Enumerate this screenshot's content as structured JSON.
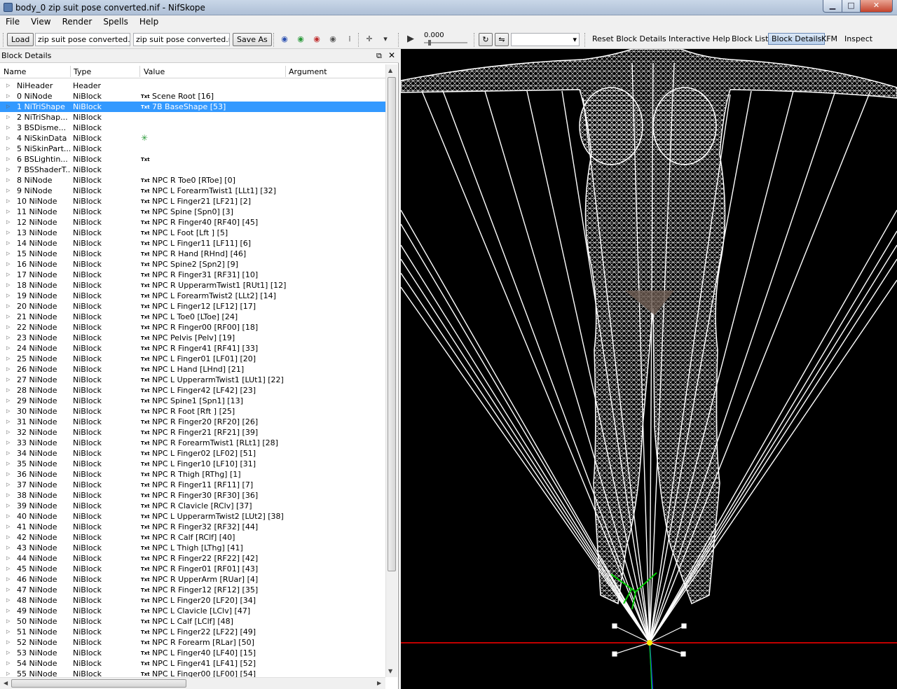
{
  "window": {
    "title": "body_0 zip suit pose converted.nif - NifSkope"
  },
  "menu": [
    "File",
    "View",
    "Render",
    "Spells",
    "Help"
  ],
  "toolbar": {
    "load": "Load",
    "file_left": "zip suit pose converted.nif",
    "file_right": "zip suit pose converted.nif",
    "save_as": "Save As",
    "time_value": "0.000",
    "links": [
      "Reset Block Details",
      "Interactive Help",
      "Block List",
      "Block Details",
      "KFM",
      "Inspect"
    ]
  },
  "panel": {
    "title": "Block Details",
    "columns": [
      "Name",
      "Type",
      "Value",
      "Argument"
    ],
    "rows": [
      {
        "name": "NiHeader",
        "type": "Header",
        "value": "",
        "txt": false
      },
      {
        "name": "0 NiNode",
        "type": "NiBlock",
        "value": "Scene Root [16]",
        "txt": true
      },
      {
        "name": "1 NiTriShape",
        "type": "NiBlock",
        "value": "7B BaseShape [53]",
        "txt": true,
        "selected": true
      },
      {
        "name": "2 NiTriShap...",
        "type": "NiBlock",
        "value": "",
        "txt": false
      },
      {
        "name": "3 BSDisme...",
        "type": "NiBlock",
        "value": "",
        "txt": false
      },
      {
        "name": "4 NiSkinData",
        "type": "NiBlock",
        "value": "",
        "txt": false,
        "axis_icon": true
      },
      {
        "name": "5 NiSkinPart...",
        "type": "NiBlock",
        "value": "",
        "txt": false
      },
      {
        "name": "6 BSLightin...",
        "type": "NiBlock",
        "value": "",
        "txt": true
      },
      {
        "name": "7 BSShaderT...",
        "type": "NiBlock",
        "value": "",
        "txt": false
      },
      {
        "name": "8 NiNode",
        "type": "NiBlock",
        "value": "NPC R Toe0 [RToe] [0]",
        "txt": true
      },
      {
        "name": "9 NiNode",
        "type": "NiBlock",
        "value": "NPC L ForearmTwist1 [LLt1] [32]",
        "txt": true
      },
      {
        "name": "10 NiNode",
        "type": "NiBlock",
        "value": "NPC L Finger21 [LF21] [2]",
        "txt": true
      },
      {
        "name": "11 NiNode",
        "type": "NiBlock",
        "value": "NPC Spine [Spn0] [3]",
        "txt": true
      },
      {
        "name": "12 NiNode",
        "type": "NiBlock",
        "value": "NPC R Finger40 [RF40] [45]",
        "txt": true
      },
      {
        "name": "13 NiNode",
        "type": "NiBlock",
        "value": "NPC L Foot [Lft ] [5]",
        "txt": true
      },
      {
        "name": "14 NiNode",
        "type": "NiBlock",
        "value": "NPC L Finger11 [LF11] [6]",
        "txt": true
      },
      {
        "name": "15 NiNode",
        "type": "NiBlock",
        "value": "NPC R Hand [RHnd] [46]",
        "txt": true
      },
      {
        "name": "16 NiNode",
        "type": "NiBlock",
        "value": "NPC Spine2 [Spn2] [9]",
        "txt": true
      },
      {
        "name": "17 NiNode",
        "type": "NiBlock",
        "value": "NPC R Finger31 [RF31] [10]",
        "txt": true
      },
      {
        "name": "18 NiNode",
        "type": "NiBlock",
        "value": "NPC R UpperarmTwist1 [RUt1] [12]",
        "txt": true
      },
      {
        "name": "19 NiNode",
        "type": "NiBlock",
        "value": "NPC L ForearmTwist2 [LLt2] [14]",
        "txt": true
      },
      {
        "name": "20 NiNode",
        "type": "NiBlock",
        "value": "NPC L Finger12 [LF12] [17]",
        "txt": true
      },
      {
        "name": "21 NiNode",
        "type": "NiBlock",
        "value": "NPC L Toe0 [LToe] [24]",
        "txt": true
      },
      {
        "name": "22 NiNode",
        "type": "NiBlock",
        "value": "NPC R Finger00 [RF00] [18]",
        "txt": true
      },
      {
        "name": "23 NiNode",
        "type": "NiBlock",
        "value": "NPC Pelvis [Pelv] [19]",
        "txt": true
      },
      {
        "name": "24 NiNode",
        "type": "NiBlock",
        "value": "NPC R Finger41 [RF41] [33]",
        "txt": true
      },
      {
        "name": "25 NiNode",
        "type": "NiBlock",
        "value": "NPC L Finger01 [LF01] [20]",
        "txt": true
      },
      {
        "name": "26 NiNode",
        "type": "NiBlock",
        "value": "NPC L Hand [LHnd] [21]",
        "txt": true
      },
      {
        "name": "27 NiNode",
        "type": "NiBlock",
        "value": "NPC L UpperarmTwist1 [LUt1] [22]",
        "txt": true
      },
      {
        "name": "28 NiNode",
        "type": "NiBlock",
        "value": "NPC L Finger42 [LF42] [23]",
        "txt": true
      },
      {
        "name": "29 NiNode",
        "type": "NiBlock",
        "value": "NPC Spine1 [Spn1] [13]",
        "txt": true
      },
      {
        "name": "30 NiNode",
        "type": "NiBlock",
        "value": "NPC R Foot [Rft ] [25]",
        "txt": true
      },
      {
        "name": "31 NiNode",
        "type": "NiBlock",
        "value": "NPC R Finger20 [RF20] [26]",
        "txt": true
      },
      {
        "name": "32 NiNode",
        "type": "NiBlock",
        "value": "NPC R Finger21 [RF21] [39]",
        "txt": true
      },
      {
        "name": "33 NiNode",
        "type": "NiBlock",
        "value": "NPC R ForearmTwist1 [RLt1] [28]",
        "txt": true
      },
      {
        "name": "34 NiNode",
        "type": "NiBlock",
        "value": "NPC L Finger02 [LF02] [51]",
        "txt": true
      },
      {
        "name": "35 NiNode",
        "type": "NiBlock",
        "value": "NPC L Finger10 [LF10] [31]",
        "txt": true
      },
      {
        "name": "36 NiNode",
        "type": "NiBlock",
        "value": "NPC R Thigh [RThg] [1]",
        "txt": true
      },
      {
        "name": "37 NiNode",
        "type": "NiBlock",
        "value": "NPC R Finger11 [RF11] [7]",
        "txt": true
      },
      {
        "name": "38 NiNode",
        "type": "NiBlock",
        "value": "NPC R Finger30 [RF30] [36]",
        "txt": true
      },
      {
        "name": "39 NiNode",
        "type": "NiBlock",
        "value": "NPC R Clavicle [RClv] [37]",
        "txt": true
      },
      {
        "name": "40 NiNode",
        "type": "NiBlock",
        "value": "NPC L UpperarmTwist2 [LUt2] [38]",
        "txt": true
      },
      {
        "name": "41 NiNode",
        "type": "NiBlock",
        "value": "NPC R Finger32 [RF32] [44]",
        "txt": true
      },
      {
        "name": "42 NiNode",
        "type": "NiBlock",
        "value": "NPC R Calf [RClf] [40]",
        "txt": true
      },
      {
        "name": "43 NiNode",
        "type": "NiBlock",
        "value": "NPC L Thigh [LThg] [41]",
        "txt": true
      },
      {
        "name": "44 NiNode",
        "type": "NiBlock",
        "value": "NPC R Finger22 [RF22] [42]",
        "txt": true
      },
      {
        "name": "45 NiNode",
        "type": "NiBlock",
        "value": "NPC R Finger01 [RF01] [43]",
        "txt": true
      },
      {
        "name": "46 NiNode",
        "type": "NiBlock",
        "value": "NPC R UpperArm [RUar] [4]",
        "txt": true
      },
      {
        "name": "47 NiNode",
        "type": "NiBlock",
        "value": "NPC R Finger12 [RF12] [35]",
        "txt": true
      },
      {
        "name": "48 NiNode",
        "type": "NiBlock",
        "value": "NPC L Finger20 [LF20] [34]",
        "txt": true
      },
      {
        "name": "49 NiNode",
        "type": "NiBlock",
        "value": "NPC L Clavicle [LClv] [47]",
        "txt": true
      },
      {
        "name": "50 NiNode",
        "type": "NiBlock",
        "value": "NPC L Calf [LClf] [48]",
        "txt": true
      },
      {
        "name": "51 NiNode",
        "type": "NiBlock",
        "value": "NPC L Finger22 [LF22] [49]",
        "txt": true
      },
      {
        "name": "52 NiNode",
        "type": "NiBlock",
        "value": "NPC R Forearm [RLar] [50]",
        "txt": true
      },
      {
        "name": "53 NiNode",
        "type": "NiBlock",
        "value": "NPC L Finger40 [LF40] [15]",
        "txt": true
      },
      {
        "name": "54 NiNode",
        "type": "NiBlock",
        "value": "NPC L Finger41 [LF41] [52]",
        "txt": true
      },
      {
        "name": "55 NiNode",
        "type": "NiBlock",
        "value": "NPC L Finger00 [LF00] [54]",
        "txt": true
      }
    ]
  },
  "colors": {
    "selection": "#3399ff",
    "viewport_bg": "#000000",
    "axis_x": "#ff0000",
    "axis_y": "#00cc00",
    "axis_z": "#0000ff"
  }
}
